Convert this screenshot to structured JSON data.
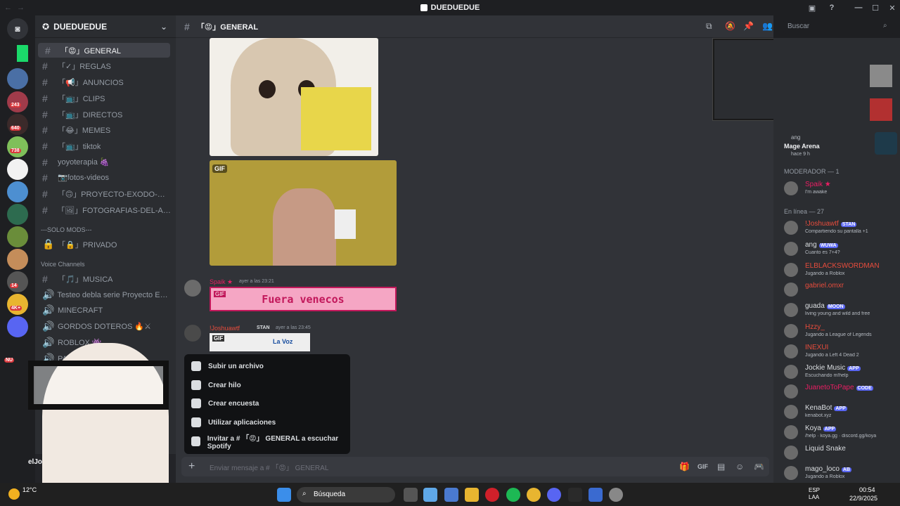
{
  "window": {
    "title": "DUEDUEDUE"
  },
  "server": {
    "name": "DUEDUEDUE"
  },
  "channels": {
    "top": [
      {
        "label": "「😡」GENERAL",
        "active": true
      },
      {
        "label": "「✓」REGLAS"
      },
      {
        "label": "「📢」ANUNCIOS"
      },
      {
        "label": "「📺」CLIPS"
      },
      {
        "label": "「📺」DIRECTOS"
      },
      {
        "label": "「😂」MEMES"
      },
      {
        "label": "「📺」tiktok"
      },
      {
        "label": "yoyoterapia 🍇"
      },
      {
        "label": "📷fotos-videos"
      },
      {
        "label": "「🙃」PROYECTO-EXODO-🙃…"
      },
      {
        "label": "「🖼」FOTOGRAFIAS-DEL-AB…"
      }
    ],
    "cat_mods": "---SOLO MODS---",
    "mods": [
      {
        "label": "「🔒」PRIVADO"
      }
    ],
    "cat_voice": "Voice Channels",
    "voice": [
      {
        "label": "「🎵」MUSICA"
      },
      {
        "label": "Testeo debla serie Proyecto Exo..."
      },
      {
        "label": "MINECRAFT"
      },
      {
        "label": "GORDOS DOTEROS 🔥⚔"
      },
      {
        "label": "ROBLOX 👾"
      },
      {
        "label": "PARTY-ANIMALS"
      }
    ]
  },
  "user_panel": {
    "name": "elJos"
  },
  "guild_badges": [
    "243",
    "640",
    "738",
    "14",
    "4K+",
    "NU"
  ],
  "header": {
    "channel": "「😡」GENERAL",
    "search_placeholder": "Buscar"
  },
  "messages": [
    {
      "author": "Spaik ★",
      "time": "ayer a las 23:21",
      "gif_text": "Fuera venecos"
    },
    {
      "author": "!Joshuawtf",
      "tag": "STAN",
      "time": "ayer a las 23:45",
      "gif_text": "La Voz"
    }
  ],
  "gif_label": "GIF",
  "popup": {
    "items": [
      "Subir un archivo",
      "Crear hilo",
      "Crear encuesta",
      "Utilizar aplicaciones",
      "Invitar a # 「😡」 GENERAL a escuchar Spotify"
    ]
  },
  "composer": {
    "placeholder": "Enviar mensaje a # 「😡」 GENERAL"
  },
  "activity": {
    "user": "ang",
    "title": "Mage Arena",
    "time": "hace 9 h"
  },
  "members": {
    "moderator_header": "MODERADOR — 1",
    "moderators": [
      {
        "name": "Spaik ★",
        "status": "I'm awake",
        "color": "#e91e63"
      }
    ],
    "online_header": "En línea — 27",
    "online": [
      {
        "name": "!Joshuawtf",
        "tag": "STAN",
        "status": "Compartiendo su pantalla +1",
        "color": "#e74c3c"
      },
      {
        "name": "ang",
        "tag": "WUWA",
        "status": "Cuanto es 7+4?",
        "color": "#dbdee1"
      },
      {
        "name": "ELBLACKSWORDMAN",
        "status": "Jugando a Roblox",
        "color": "#e74c3c"
      },
      {
        "name": "gabriel.omxr",
        "status": "",
        "color": "#e74c3c"
      },
      {
        "name": "guada",
        "tag": "MOON",
        "status": "living young and wild and free",
        "color": "#dbdee1"
      },
      {
        "name": "Hzzy_",
        "status": "Jugando a League of Legends",
        "color": "#e74c3c"
      },
      {
        "name": "INEXUI",
        "status": "Jugando a Left 4 Dead 2",
        "color": "#e74c3c"
      },
      {
        "name": "Jockie Music",
        "tag": "APP",
        "status": "Escuchando m!help",
        "color": "#dbdee1"
      },
      {
        "name": "JuanetoToPape",
        "tag": "CODE",
        "status": "",
        "color": "#e91e63"
      },
      {
        "name": "KenaBot",
        "tag": "APP",
        "status": "kenabot.xyz",
        "color": "#dbdee1"
      },
      {
        "name": "Koya",
        "tag": "APP",
        "status": "/help · koya.gg · discord.gg/koya",
        "color": "#dbdee1"
      },
      {
        "name": "Liquid Snake",
        "status": "",
        "color": "#dbdee1"
      },
      {
        "name": "mago_loco",
        "tag": "AB",
        "status": "Jugando a Roblox",
        "color": "#dbdee1"
      }
    ]
  },
  "taskbar": {
    "search": "Búsqueda",
    "weather": "12°C",
    "lang": "ESP",
    "lang2": "LAA",
    "time": "00:54",
    "date": "22/9/2025"
  }
}
